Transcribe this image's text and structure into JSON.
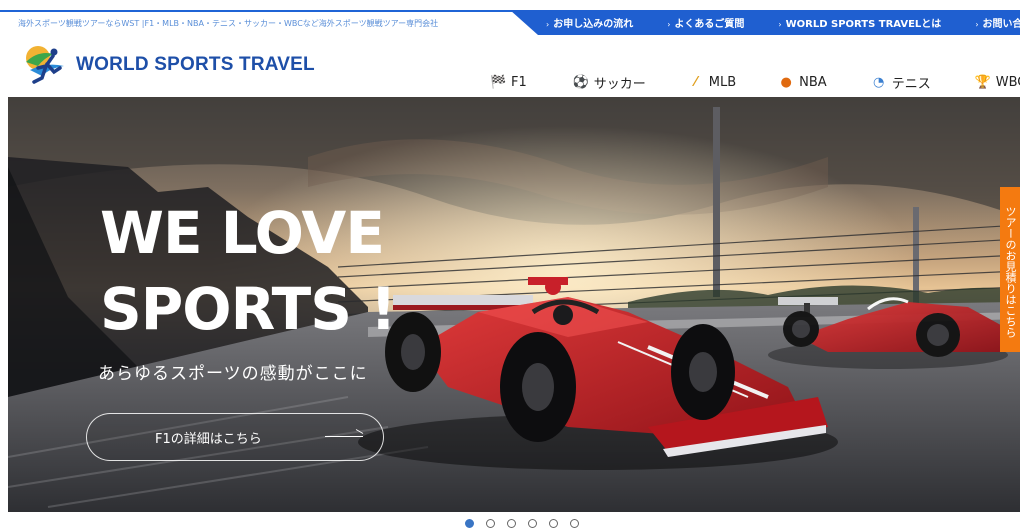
{
  "header": {
    "tagline": "海外スポーツ観戦ツアーならWST |F1・MLB・NBA・テニス・サッカー・WBCなど海外スポーツ観戦ツアー専門会社",
    "top_nav": [
      {
        "label": "お申し込みの流れ",
        "chevron": "›"
      },
      {
        "label": "よくあるご質問",
        "chevron": "›"
      },
      {
        "label": "WORLD SPORTS TRAVELとは",
        "chevron": "›"
      },
      {
        "label": "お問い合わせ",
        "chevron": "›"
      }
    ],
    "logo_text": "WORLD SPORTS TRAVEL",
    "sport_nav": [
      {
        "label": "F1",
        "icon": "checkered-flag-icon",
        "glyph": "🏁"
      },
      {
        "label": "サッカー",
        "icon": "soccer-ball-icon",
        "glyph": "⚽"
      },
      {
        "label": "MLB",
        "icon": "baseball-bat-icon",
        "glyph": "⁄"
      },
      {
        "label": "NBA",
        "icon": "basketball-icon",
        "glyph": "●"
      },
      {
        "label": "テニス",
        "icon": "tennis-racket-icon",
        "glyph": "◔"
      },
      {
        "label": "WBC",
        "icon": "trophy-icon",
        "glyph": "🏆"
      }
    ]
  },
  "hero": {
    "title_line1": "WE LOVE",
    "title_line2": "SPORTS !",
    "subtitle": "あらゆるスポーツの感動がここに",
    "button_label": "F1の詳細はこちら"
  },
  "side_tab": {
    "label": "ツアーのお見積りはこちら"
  },
  "carousel": {
    "slide_count": 6,
    "active_index": 0
  },
  "colors": {
    "brand_blue": "#1f5fd0",
    "logo_blue": "#1e4fa8",
    "orange": "#f47a10",
    "car_red": "#c8202a"
  }
}
